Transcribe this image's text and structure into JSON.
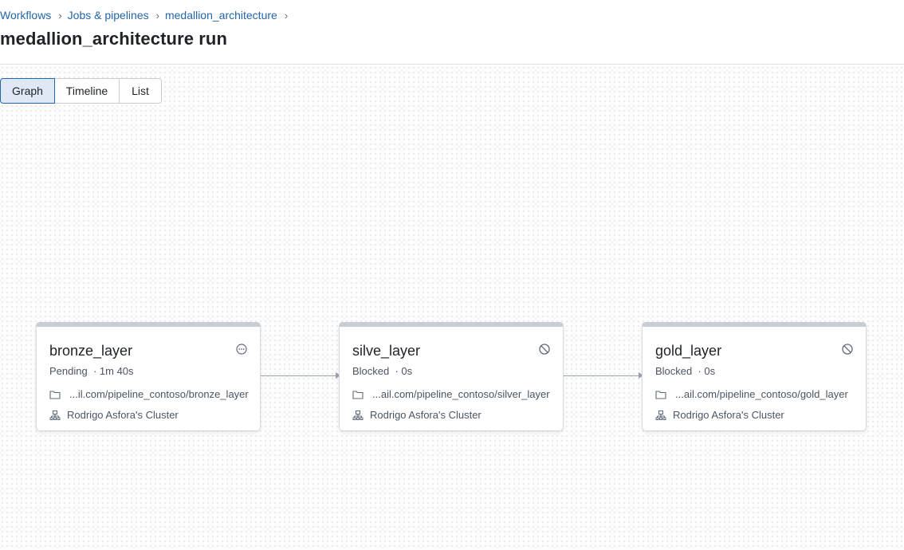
{
  "breadcrumb": {
    "items": [
      "Workflows",
      "Jobs & pipelines",
      "medallion_architecture"
    ],
    "separator": "›"
  },
  "page": {
    "title": "medallion_architecture run"
  },
  "view_toggle": {
    "options": [
      "Graph",
      "Timeline",
      "List"
    ],
    "selected": "Graph"
  },
  "tasks": [
    {
      "name": "bronze_layer",
      "status": "Pending",
      "duration": "· 1m 40s",
      "status_icon": "pending-icon",
      "path": "...il.com/pipeline_contoso/bronze_layer",
      "cluster": "Rodrigo Asfora's Cluster"
    },
    {
      "name": "silve_layer",
      "status": "Blocked",
      "duration": "· 0s",
      "status_icon": "blocked-icon",
      "path": "...ail.com/pipeline_contoso/silver_layer",
      "cluster": "Rodrigo Asfora's Cluster"
    },
    {
      "name": "gold_layer",
      "status": "Blocked",
      "duration": "· 0s",
      "status_icon": "blocked-icon",
      "path": "...ail.com/pipeline_contoso/gold_layer",
      "cluster": "Rodrigo Asfora's Cluster"
    }
  ],
  "colors": {
    "link": "#2466a8",
    "selected_tab_bg": "#dfe9f5",
    "edge": "#9aa3ad",
    "card_top_bar": "#c9ced4"
  }
}
